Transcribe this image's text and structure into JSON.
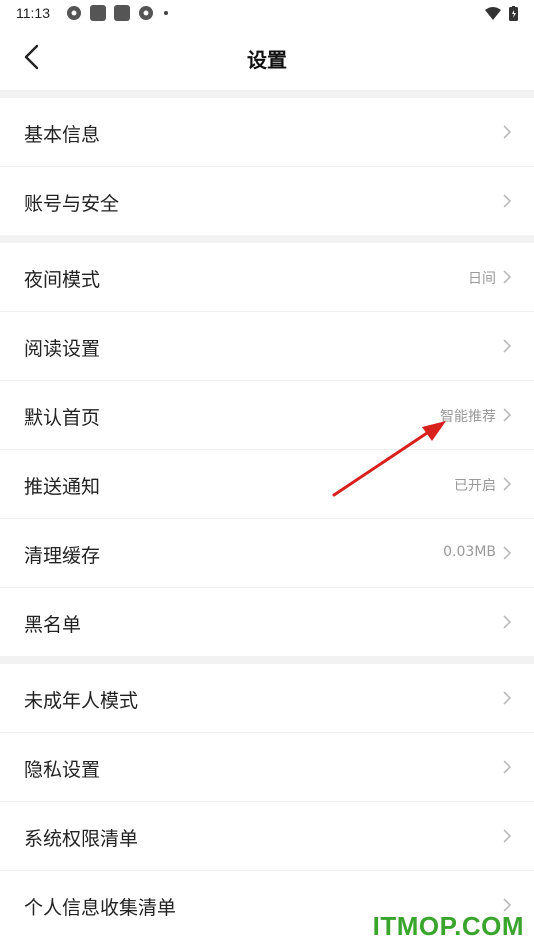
{
  "status": {
    "time": "11:13"
  },
  "header": {
    "title": "设置"
  },
  "groups": [
    [
      {
        "label": "基本信息",
        "value": ""
      },
      {
        "label": "账号与安全",
        "value": ""
      }
    ],
    [
      {
        "label": "夜间模式",
        "value": "日间"
      },
      {
        "label": "阅读设置",
        "value": ""
      },
      {
        "label": "默认首页",
        "value": "智能推荐"
      },
      {
        "label": "推送通知",
        "value": "已开启"
      },
      {
        "label": "清理缓存",
        "value": "0.03MB"
      },
      {
        "label": "黑名单",
        "value": ""
      }
    ],
    [
      {
        "label": "未成年人模式",
        "value": ""
      },
      {
        "label": "隐私设置",
        "value": ""
      },
      {
        "label": "系统权限清单",
        "value": ""
      },
      {
        "label": "个人信息收集清单",
        "value": ""
      }
    ]
  ],
  "watermark": "ITMOP.COM",
  "colors": {
    "annotation_arrow": "#d8211c",
    "watermark": "#3aa52c"
  }
}
